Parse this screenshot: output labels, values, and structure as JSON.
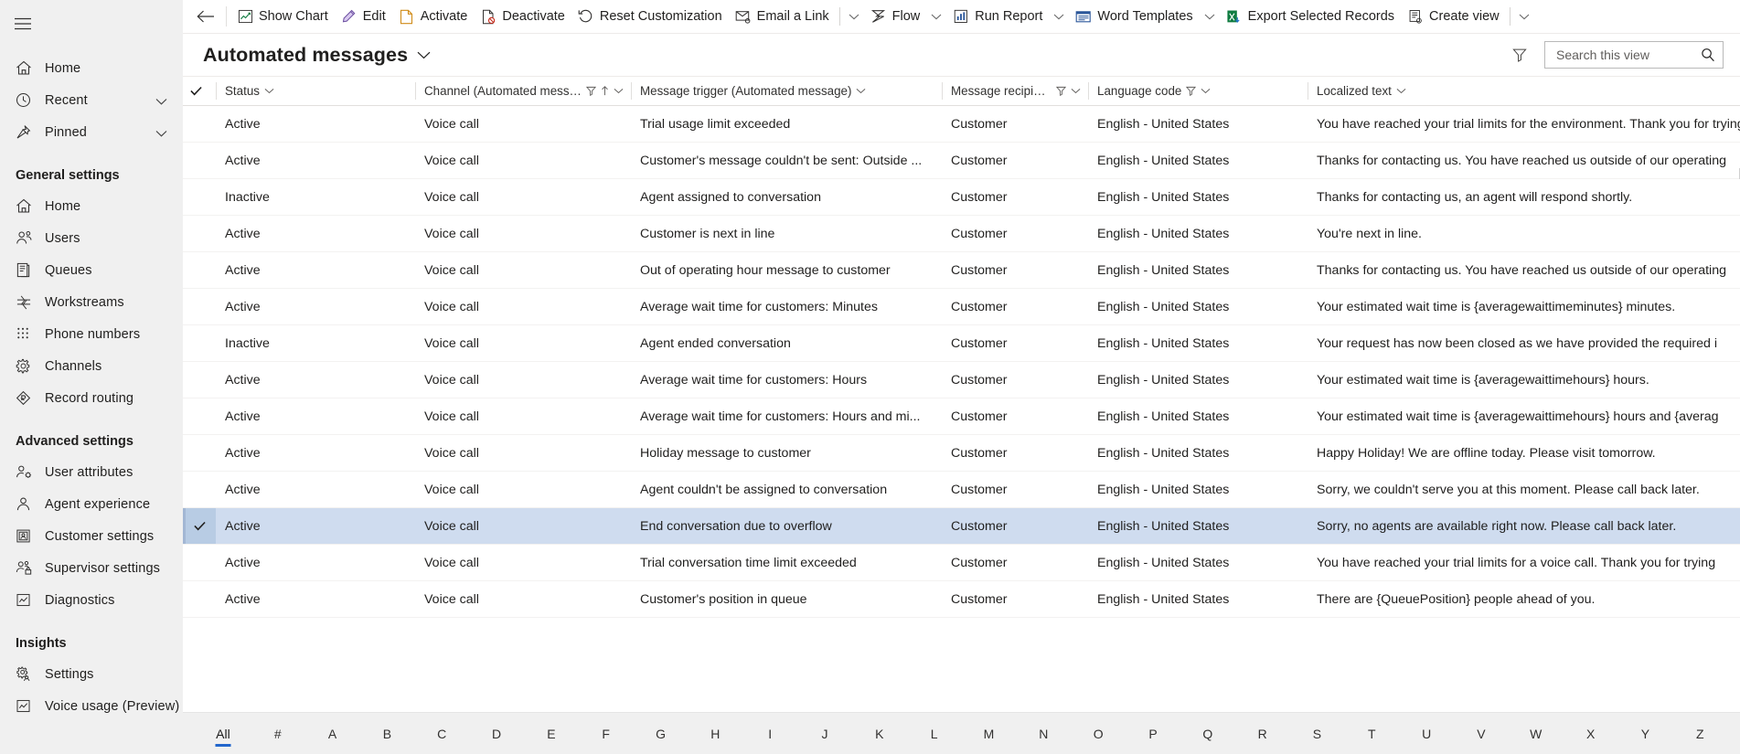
{
  "sidebar": {
    "hamburger": "site-map-toggle",
    "top_items": [
      {
        "label": "Home",
        "icon": "home-icon",
        "chevron": false
      },
      {
        "label": "Recent",
        "icon": "clock-icon",
        "chevron": true
      },
      {
        "label": "Pinned",
        "icon": "pin-icon",
        "chevron": true
      }
    ],
    "groups": [
      {
        "title": "General settings",
        "items": [
          {
            "label": "Home",
            "icon": "home-icon"
          },
          {
            "label": "Users",
            "icon": "users-icon"
          },
          {
            "label": "Queues",
            "icon": "queues-icon"
          },
          {
            "label": "Workstreams",
            "icon": "workstreams-icon"
          },
          {
            "label": "Phone numbers",
            "icon": "dialpad-icon"
          },
          {
            "label": "Channels",
            "icon": "gear-icon"
          },
          {
            "label": "Record routing",
            "icon": "record-routing-icon"
          }
        ]
      },
      {
        "title": "Advanced settings",
        "items": [
          {
            "label": "User attributes",
            "icon": "user-attributes-icon"
          },
          {
            "label": "Agent experience",
            "icon": "agent-icon"
          },
          {
            "label": "Customer settings",
            "icon": "customer-card-icon"
          },
          {
            "label": "Supervisor settings",
            "icon": "supervisor-icon"
          },
          {
            "label": "Diagnostics",
            "icon": "chart-box-icon"
          }
        ]
      },
      {
        "title": "Insights",
        "items": [
          {
            "label": "Settings",
            "icon": "gear-people-icon"
          },
          {
            "label": "Voice usage (Preview)",
            "icon": "chart-box-icon"
          }
        ]
      }
    ]
  },
  "commandbar": {
    "back": "back-arrow",
    "buttons": [
      {
        "label": "Show Chart",
        "icon": "chart-icon",
        "caret": false,
        "divider_before": false
      },
      {
        "label": "Edit",
        "icon": "pencil-icon",
        "caret": false,
        "divider_before": false
      },
      {
        "label": "Activate",
        "icon": "activate-icon",
        "caret": false,
        "divider_before": false
      },
      {
        "label": "Deactivate",
        "icon": "deactivate-icon",
        "caret": false,
        "divider_before": false
      },
      {
        "label": "Reset Customization",
        "icon": "reset-icon",
        "caret": false,
        "divider_before": false
      },
      {
        "label": "Email a Link",
        "icon": "email-link-icon",
        "caret": true,
        "divider_before": false,
        "pipe_after": true
      },
      {
        "label": "Flow",
        "icon": "flow-icon",
        "caret": true,
        "divider_before": false
      },
      {
        "label": "Run Report",
        "icon": "report-icon",
        "caret": true,
        "divider_before": false
      },
      {
        "label": "Word Templates",
        "icon": "word-icon",
        "caret": true,
        "divider_before": false
      },
      {
        "label": "Export Selected Records",
        "icon": "excel-icon",
        "caret": false,
        "divider_before": false
      },
      {
        "label": "Create view",
        "icon": "create-view-icon",
        "caret": true,
        "divider_before": false,
        "pipe_after": true
      }
    ]
  },
  "view": {
    "title": "Automated messages",
    "title_caret": "chevron-down-icon",
    "filter_icon": "filter-icon",
    "search_placeholder": "Search this view",
    "search_value": ""
  },
  "grid": {
    "select_all_icon": "checkmark-icon",
    "columns": [
      {
        "key": "status",
        "label": "Status",
        "filter": false,
        "sort": false,
        "caret": true
      },
      {
        "key": "channel",
        "label": "Channel (Automated message)",
        "filter": true,
        "sort": true,
        "caret": true
      },
      {
        "key": "trigger",
        "label": "Message trigger (Automated message)",
        "filter": false,
        "sort": false,
        "caret": true
      },
      {
        "key": "recipient",
        "label": "Message recipient (...",
        "filter": true,
        "sort": false,
        "caret": true
      },
      {
        "key": "language",
        "label": "Language code",
        "filter": true,
        "sort": false,
        "caret": true
      },
      {
        "key": "localized",
        "label": "Localized text",
        "filter": false,
        "sort": false,
        "caret": true
      }
    ],
    "rows": [
      {
        "selected": false,
        "status": "Active",
        "channel": "Voice call",
        "trigger": "Trial usage limit exceeded",
        "recipient": "Customer",
        "language": "English - United States",
        "localized": "You have reached your trial limits for the environment. Thank you for trying"
      },
      {
        "selected": false,
        "status": "Active",
        "channel": "Voice call",
        "trigger": "Customer's message couldn't be sent: Outside ...",
        "recipient": "Customer",
        "language": "English - United States",
        "localized": "Thanks for contacting us. You have reached us outside of our operating"
      },
      {
        "selected": false,
        "status": "Inactive",
        "channel": "Voice call",
        "trigger": "Agent assigned to conversation",
        "recipient": "Customer",
        "language": "English - United States",
        "localized": "Thanks for contacting us, an agent will respond shortly."
      },
      {
        "selected": false,
        "status": "Active",
        "channel": "Voice call",
        "trigger": "Customer is next in line",
        "recipient": "Customer",
        "language": "English - United States",
        "localized": "You're next in line."
      },
      {
        "selected": false,
        "status": "Active",
        "channel": "Voice call",
        "trigger": "Out of operating hour message to customer",
        "recipient": "Customer",
        "language": "English - United States",
        "localized": "Thanks for contacting us. You have reached us outside of our operating"
      },
      {
        "selected": false,
        "status": "Active",
        "channel": "Voice call",
        "trigger": "Average wait time for customers: Minutes",
        "recipient": "Customer",
        "language": "English - United States",
        "localized": "Your estimated wait time is {averagewaittimeminutes} minutes."
      },
      {
        "selected": false,
        "status": "Inactive",
        "channel": "Voice call",
        "trigger": "Agent ended conversation",
        "recipient": "Customer",
        "language": "English - United States",
        "localized": "Your request has now been closed as we have provided the required i"
      },
      {
        "selected": false,
        "status": "Active",
        "channel": "Voice call",
        "trigger": "Average wait time for customers: Hours",
        "recipient": "Customer",
        "language": "English - United States",
        "localized": "Your estimated wait time is {averagewaittimehours} hours."
      },
      {
        "selected": false,
        "status": "Active",
        "channel": "Voice call",
        "trigger": "Average wait time for customers: Hours and mi...",
        "recipient": "Customer",
        "language": "English - United States",
        "localized": "Your estimated wait time is {averagewaittimehours} hours and {averag"
      },
      {
        "selected": false,
        "status": "Active",
        "channel": "Voice call",
        "trigger": "Holiday message to customer",
        "recipient": "Customer",
        "language": "English - United States",
        "localized": "Happy Holiday! We are offline today. Please visit tomorrow."
      },
      {
        "selected": false,
        "status": "Active",
        "channel": "Voice call",
        "trigger": "Agent couldn't be assigned to conversation",
        "recipient": "Customer",
        "language": "English - United States",
        "localized": "Sorry, we couldn't serve you at this moment. Please call back later."
      },
      {
        "selected": true,
        "status": "Active",
        "channel": "Voice call",
        "trigger": "End conversation due to overflow",
        "recipient": "Customer",
        "language": "English - United States",
        "localized": "Sorry, no agents are available right now. Please call back later."
      },
      {
        "selected": false,
        "status": "Active",
        "channel": "Voice call",
        "trigger": "Trial conversation time limit exceeded",
        "recipient": "Customer",
        "language": "English - United States",
        "localized": "You have reached your trial limits for a voice call. Thank you for trying"
      },
      {
        "selected": false,
        "status": "Active",
        "channel": "Voice call",
        "trigger": "Customer's position in queue",
        "recipient": "Customer",
        "language": "English - United States",
        "localized": "There are {QueuePosition} people ahead of you."
      }
    ]
  },
  "alphabar": {
    "active": "All",
    "items": [
      "All",
      "#",
      "A",
      "B",
      "C",
      "D",
      "E",
      "F",
      "G",
      "H",
      "I",
      "J",
      "K",
      "L",
      "M",
      "N",
      "O",
      "P",
      "Q",
      "R",
      "S",
      "T",
      "U",
      "V",
      "W",
      "X",
      "Y",
      "Z"
    ]
  },
  "colors": {
    "accent": "#2266cc",
    "link": "#2266aa",
    "selection": "#cfdcef",
    "sidebar_bg": "#f0f0f0"
  }
}
